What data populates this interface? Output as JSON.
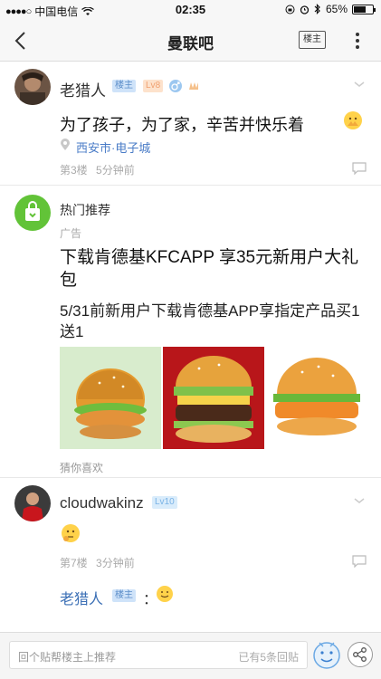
{
  "status_bar": {
    "carrier": "中国电信",
    "time": "02:35",
    "battery": "65%",
    "battery_level": 0.65
  },
  "nav": {
    "title": "曼联吧",
    "owner_button": "楼主"
  },
  "post1": {
    "username": "老猎人",
    "badge_owner": "楼主",
    "badge_level": "8",
    "text": "为了孩子，为了家，辛苦并快乐着",
    "location": "西安市·电子城",
    "floor": "第3楼",
    "time": "5分钟前"
  },
  "ad": {
    "source": "热门推荐",
    "label": "广告",
    "title": "下载肯德基KFCAPP 享35元新用户大礼包",
    "description": "5/31前新用户下载肯德基APP享指定产品买1送1",
    "footer": "猜你喜欢"
  },
  "post2": {
    "username": "cloudwakinz",
    "badge_level": "10",
    "floor": "第7楼",
    "time": "3分钟前"
  },
  "reply": {
    "username": "老猎人",
    "badge_owner": "楼主",
    "separator": "："
  },
  "bottom": {
    "placeholder": "回个贴帮楼主上推荐",
    "count": "已有5条回贴"
  }
}
